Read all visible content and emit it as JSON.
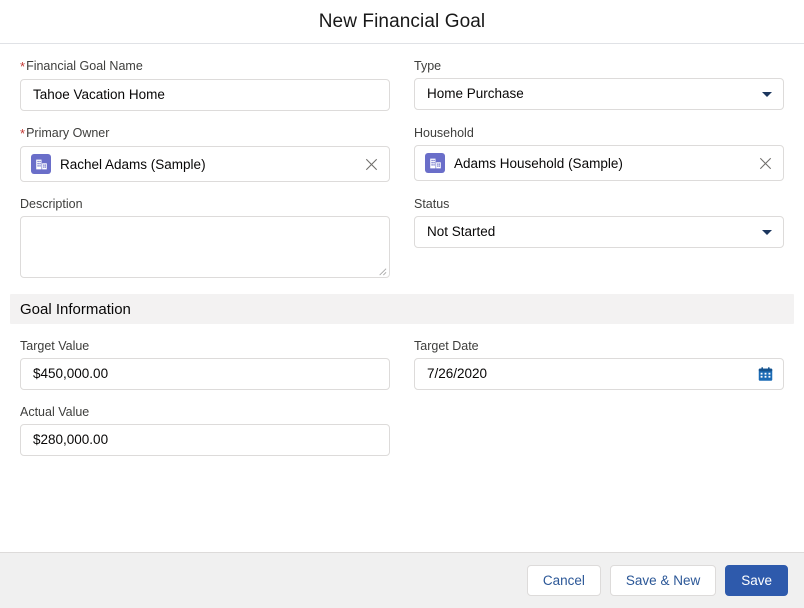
{
  "header": {
    "title": "New Financial Goal"
  },
  "form": {
    "fields": [
      {
        "id": "financial-goal-name",
        "label": "Financial Goal Name",
        "required": true,
        "type": "text",
        "value": "Tahoe Vacation Home",
        "placeholder": ""
      },
      {
        "id": "type",
        "label": "Type",
        "required": false,
        "type": "combobox",
        "value": "Home Purchase",
        "icon": "chevron-down-icon"
      },
      {
        "id": "primary-owner",
        "label": "Primary Owner",
        "required": true,
        "type": "lookup",
        "value": "Rachel Adams (Sample)",
        "record_icon": "account-icon",
        "clear_icon": "close-icon"
      },
      {
        "id": "household",
        "label": "Household",
        "required": false,
        "type": "lookup",
        "value": "Adams Household (Sample)",
        "record_icon": "account-icon",
        "clear_icon": "close-icon"
      },
      {
        "id": "description",
        "label": "Description",
        "required": false,
        "type": "textarea",
        "value": "",
        "placeholder": ""
      },
      {
        "id": "status",
        "label": "Status",
        "required": false,
        "type": "combobox",
        "value": "Not Started",
        "icon": "chevron-down-icon"
      }
    ],
    "section": {
      "title": "Goal Information",
      "fields": [
        {
          "id": "target-value",
          "label": "Target Value",
          "required": false,
          "type": "text",
          "value": "$450,000.00",
          "placeholder": ""
        },
        {
          "id": "target-date",
          "label": "Target Date",
          "required": false,
          "type": "date",
          "value": "7/26/2020",
          "placeholder": "",
          "icon": "calendar-icon"
        },
        {
          "id": "actual-value",
          "label": "Actual Value",
          "required": false,
          "type": "text",
          "value": "$280,000.00",
          "placeholder": ""
        }
      ]
    },
    "required_marker": "*"
  },
  "footer": {
    "cancel_label": "Cancel",
    "save_new_label": "Save & New",
    "save_label": "Save"
  },
  "colors": {
    "brand_blue": "#2e5aac",
    "link_blue": "#2b5797",
    "required_red": "#c23934",
    "section_bg": "#f3f2f2",
    "footer_bg": "#f0f0f0",
    "border": "#dddbda",
    "pill_icon_bg": "#6a6ec9"
  }
}
